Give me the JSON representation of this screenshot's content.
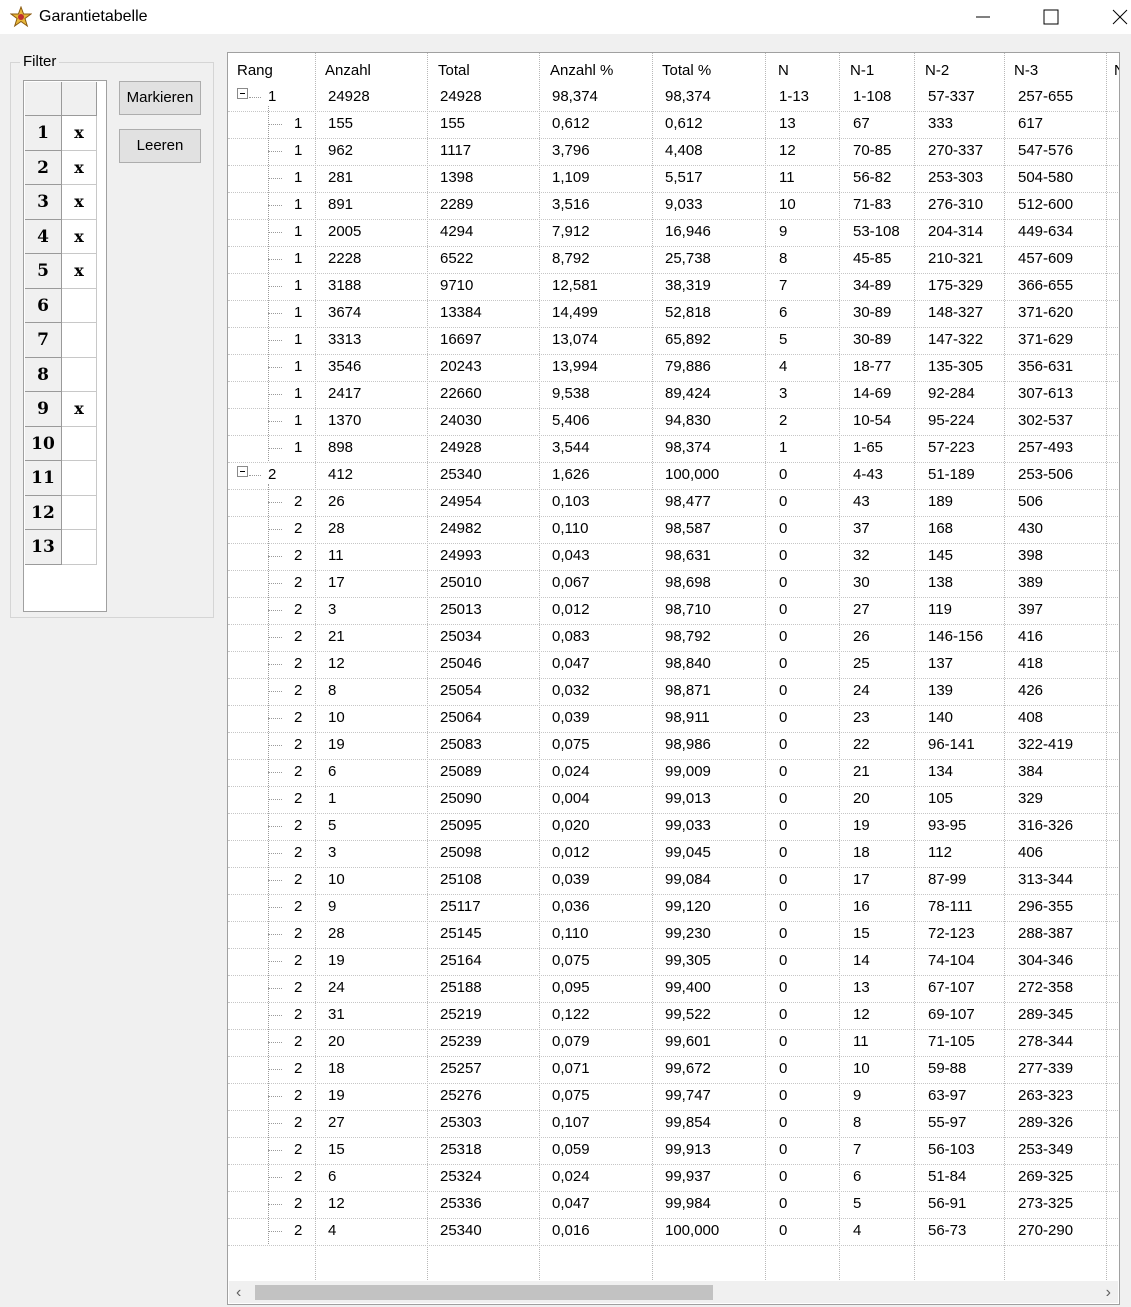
{
  "window": {
    "title": "Garantietabelle",
    "app_icon": "star-icon"
  },
  "filter": {
    "legend": "Filter",
    "rows": [
      {
        "num": "1",
        "mark": "x"
      },
      {
        "num": "2",
        "mark": "x"
      },
      {
        "num": "3",
        "mark": "x"
      },
      {
        "num": "4",
        "mark": "x"
      },
      {
        "num": "5",
        "mark": "x"
      },
      {
        "num": "6",
        "mark": ""
      },
      {
        "num": "7",
        "mark": ""
      },
      {
        "num": "8",
        "mark": ""
      },
      {
        "num": "9",
        "mark": "x"
      },
      {
        "num": "10",
        "mark": ""
      },
      {
        "num": "11",
        "mark": ""
      },
      {
        "num": "12",
        "mark": ""
      },
      {
        "num": "13",
        "mark": ""
      }
    ],
    "buttons": {
      "markieren": "Markieren",
      "leeren": "Leeren"
    }
  },
  "table": {
    "columns": [
      "Rang",
      "Anzahl",
      "Total",
      "Anzahl %",
      "Total %",
      "N",
      "N-1",
      "N-2",
      "N-3",
      "N"
    ],
    "rows": [
      {
        "level": 0,
        "expander": true,
        "rang": "1",
        "anzahl": "24928",
        "total": "24928",
        "anzahl_pct": "98,374",
        "total_pct": "98,374",
        "n": "1-13",
        "n1": "1-108",
        "n2": "57-337",
        "n3": "257-655"
      },
      {
        "level": 1,
        "rang": "1",
        "anzahl": "155",
        "total": "155",
        "anzahl_pct": "0,612",
        "total_pct": "0,612",
        "n": "13",
        "n1": "67",
        "n2": "333",
        "n3": "617"
      },
      {
        "level": 1,
        "rang": "1",
        "anzahl": "962",
        "total": "1117",
        "anzahl_pct": "3,796",
        "total_pct": "4,408",
        "n": "12",
        "n1": "70-85",
        "n2": "270-337",
        "n3": "547-576"
      },
      {
        "level": 1,
        "rang": "1",
        "anzahl": "281",
        "total": "1398",
        "anzahl_pct": "1,109",
        "total_pct": "5,517",
        "n": "11",
        "n1": "56-82",
        "n2": "253-303",
        "n3": "504-580"
      },
      {
        "level": 1,
        "rang": "1",
        "anzahl": "891",
        "total": "2289",
        "anzahl_pct": "3,516",
        "total_pct": "9,033",
        "n": "10",
        "n1": "71-83",
        "n2": "276-310",
        "n3": "512-600"
      },
      {
        "level": 1,
        "rang": "1",
        "anzahl": "2005",
        "total": "4294",
        "anzahl_pct": "7,912",
        "total_pct": "16,946",
        "n": "9",
        "n1": "53-108",
        "n2": "204-314",
        "n3": "449-634"
      },
      {
        "level": 1,
        "rang": "1",
        "anzahl": "2228",
        "total": "6522",
        "anzahl_pct": "8,792",
        "total_pct": "25,738",
        "n": "8",
        "n1": "45-85",
        "n2": "210-321",
        "n3": "457-609"
      },
      {
        "level": 1,
        "rang": "1",
        "anzahl": "3188",
        "total": "9710",
        "anzahl_pct": "12,581",
        "total_pct": "38,319",
        "n": "7",
        "n1": "34-89",
        "n2": "175-329",
        "n3": "366-655"
      },
      {
        "level": 1,
        "rang": "1",
        "anzahl": "3674",
        "total": "13384",
        "anzahl_pct": "14,499",
        "total_pct": "52,818",
        "n": "6",
        "n1": "30-89",
        "n2": "148-327",
        "n3": "371-620"
      },
      {
        "level": 1,
        "rang": "1",
        "anzahl": "3313",
        "total": "16697",
        "anzahl_pct": "13,074",
        "total_pct": "65,892",
        "n": "5",
        "n1": "30-89",
        "n2": "147-322",
        "n3": "371-629"
      },
      {
        "level": 1,
        "rang": "1",
        "anzahl": "3546",
        "total": "20243",
        "anzahl_pct": "13,994",
        "total_pct": "79,886",
        "n": "4",
        "n1": "18-77",
        "n2": "135-305",
        "n3": "356-631"
      },
      {
        "level": 1,
        "rang": "1",
        "anzahl": "2417",
        "total": "22660",
        "anzahl_pct": "9,538",
        "total_pct": "89,424",
        "n": "3",
        "n1": "14-69",
        "n2": "92-284",
        "n3": "307-613"
      },
      {
        "level": 1,
        "rang": "1",
        "anzahl": "1370",
        "total": "24030",
        "anzahl_pct": "5,406",
        "total_pct": "94,830",
        "n": "2",
        "n1": "10-54",
        "n2": "95-224",
        "n3": "302-537"
      },
      {
        "level": 1,
        "rang": "1",
        "anzahl": "898",
        "total": "24928",
        "anzahl_pct": "3,544",
        "total_pct": "98,374",
        "n": "1",
        "n1": "1-65",
        "n2": "57-223",
        "n3": "257-493"
      },
      {
        "level": 0,
        "expander": true,
        "rang": "2",
        "anzahl": "412",
        "total": "25340",
        "anzahl_pct": "1,626",
        "total_pct": "100,000",
        "n": "0",
        "n1": "4-43",
        "n2": "51-189",
        "n3": "253-506"
      },
      {
        "level": 1,
        "rang": "2",
        "anzahl": "26",
        "total": "24954",
        "anzahl_pct": "0,103",
        "total_pct": "98,477",
        "n": "0",
        "n1": "43",
        "n2": "189",
        "n3": "506"
      },
      {
        "level": 1,
        "rang": "2",
        "anzahl": "28",
        "total": "24982",
        "anzahl_pct": "0,110",
        "total_pct": "98,587",
        "n": "0",
        "n1": "37",
        "n2": "168",
        "n3": "430"
      },
      {
        "level": 1,
        "rang": "2",
        "anzahl": "11",
        "total": "24993",
        "anzahl_pct": "0,043",
        "total_pct": "98,631",
        "n": "0",
        "n1": "32",
        "n2": "145",
        "n3": "398"
      },
      {
        "level": 1,
        "rang": "2",
        "anzahl": "17",
        "total": "25010",
        "anzahl_pct": "0,067",
        "total_pct": "98,698",
        "n": "0",
        "n1": "30",
        "n2": "138",
        "n3": "389"
      },
      {
        "level": 1,
        "rang": "2",
        "anzahl": "3",
        "total": "25013",
        "anzahl_pct": "0,012",
        "total_pct": "98,710",
        "n": "0",
        "n1": "27",
        "n2": "119",
        "n3": "397"
      },
      {
        "level": 1,
        "rang": "2",
        "anzahl": "21",
        "total": "25034",
        "anzahl_pct": "0,083",
        "total_pct": "98,792",
        "n": "0",
        "n1": "26",
        "n2": "146-156",
        "n3": "416"
      },
      {
        "level": 1,
        "rang": "2",
        "anzahl": "12",
        "total": "25046",
        "anzahl_pct": "0,047",
        "total_pct": "98,840",
        "n": "0",
        "n1": "25",
        "n2": "137",
        "n3": "418"
      },
      {
        "level": 1,
        "rang": "2",
        "anzahl": "8",
        "total": "25054",
        "anzahl_pct": "0,032",
        "total_pct": "98,871",
        "n": "0",
        "n1": "24",
        "n2": "139",
        "n3": "426"
      },
      {
        "level": 1,
        "rang": "2",
        "anzahl": "10",
        "total": "25064",
        "anzahl_pct": "0,039",
        "total_pct": "98,911",
        "n": "0",
        "n1": "23",
        "n2": "140",
        "n3": "408"
      },
      {
        "level": 1,
        "rang": "2",
        "anzahl": "19",
        "total": "25083",
        "anzahl_pct": "0,075",
        "total_pct": "98,986",
        "n": "0",
        "n1": "22",
        "n2": "96-141",
        "n3": "322-419"
      },
      {
        "level": 1,
        "rang": "2",
        "anzahl": "6",
        "total": "25089",
        "anzahl_pct": "0,024",
        "total_pct": "99,009",
        "n": "0",
        "n1": "21",
        "n2": "134",
        "n3": "384"
      },
      {
        "level": 1,
        "rang": "2",
        "anzahl": "1",
        "total": "25090",
        "anzahl_pct": "0,004",
        "total_pct": "99,013",
        "n": "0",
        "n1": "20",
        "n2": "105",
        "n3": "329"
      },
      {
        "level": 1,
        "rang": "2",
        "anzahl": "5",
        "total": "25095",
        "anzahl_pct": "0,020",
        "total_pct": "99,033",
        "n": "0",
        "n1": "19",
        "n2": "93-95",
        "n3": "316-326"
      },
      {
        "level": 1,
        "rang": "2",
        "anzahl": "3",
        "total": "25098",
        "anzahl_pct": "0,012",
        "total_pct": "99,045",
        "n": "0",
        "n1": "18",
        "n2": "112",
        "n3": "406"
      },
      {
        "level": 1,
        "rang": "2",
        "anzahl": "10",
        "total": "25108",
        "anzahl_pct": "0,039",
        "total_pct": "99,084",
        "n": "0",
        "n1": "17",
        "n2": "87-99",
        "n3": "313-344"
      },
      {
        "level": 1,
        "rang": "2",
        "anzahl": "9",
        "total": "25117",
        "anzahl_pct": "0,036",
        "total_pct": "99,120",
        "n": "0",
        "n1": "16",
        "n2": "78-111",
        "n3": "296-355"
      },
      {
        "level": 1,
        "rang": "2",
        "anzahl": "28",
        "total": "25145",
        "anzahl_pct": "0,110",
        "total_pct": "99,230",
        "n": "0",
        "n1": "15",
        "n2": "72-123",
        "n3": "288-387"
      },
      {
        "level": 1,
        "rang": "2",
        "anzahl": "19",
        "total": "25164",
        "anzahl_pct": "0,075",
        "total_pct": "99,305",
        "n": "0",
        "n1": "14",
        "n2": "74-104",
        "n3": "304-346"
      },
      {
        "level": 1,
        "rang": "2",
        "anzahl": "24",
        "total": "25188",
        "anzahl_pct": "0,095",
        "total_pct": "99,400",
        "n": "0",
        "n1": "13",
        "n2": "67-107",
        "n3": "272-358"
      },
      {
        "level": 1,
        "rang": "2",
        "anzahl": "31",
        "total": "25219",
        "anzahl_pct": "0,122",
        "total_pct": "99,522",
        "n": "0",
        "n1": "12",
        "n2": "69-107",
        "n3": "289-345"
      },
      {
        "level": 1,
        "rang": "2",
        "anzahl": "20",
        "total": "25239",
        "anzahl_pct": "0,079",
        "total_pct": "99,601",
        "n": "0",
        "n1": "11",
        "n2": "71-105",
        "n3": "278-344"
      },
      {
        "level": 1,
        "rang": "2",
        "anzahl": "18",
        "total": "25257",
        "anzahl_pct": "0,071",
        "total_pct": "99,672",
        "n": "0",
        "n1": "10",
        "n2": "59-88",
        "n3": "277-339"
      },
      {
        "level": 1,
        "rang": "2",
        "anzahl": "19",
        "total": "25276",
        "anzahl_pct": "0,075",
        "total_pct": "99,747",
        "n": "0",
        "n1": "9",
        "n2": "63-97",
        "n3": "263-323"
      },
      {
        "level": 1,
        "rang": "2",
        "anzahl": "27",
        "total": "25303",
        "anzahl_pct": "0,107",
        "total_pct": "99,854",
        "n": "0",
        "n1": "8",
        "n2": "55-97",
        "n3": "289-326"
      },
      {
        "level": 1,
        "rang": "2",
        "anzahl": "15",
        "total": "25318",
        "anzahl_pct": "0,059",
        "total_pct": "99,913",
        "n": "0",
        "n1": "7",
        "n2": "56-103",
        "n3": "253-349"
      },
      {
        "level": 1,
        "rang": "2",
        "anzahl": "6",
        "total": "25324",
        "anzahl_pct": "0,024",
        "total_pct": "99,937",
        "n": "0",
        "n1": "6",
        "n2": "51-84",
        "n3": "269-325"
      },
      {
        "level": 1,
        "rang": "2",
        "anzahl": "12",
        "total": "25336",
        "anzahl_pct": "0,047",
        "total_pct": "99,984",
        "n": "0",
        "n1": "5",
        "n2": "56-91",
        "n3": "273-325"
      },
      {
        "level": 1,
        "rang": "2",
        "anzahl": "4",
        "total": "25340",
        "anzahl_pct": "0,016",
        "total_pct": "100,000",
        "n": "0",
        "n1": "4",
        "n2": "56-73",
        "n3": "270-290"
      }
    ]
  },
  "scrollbar": {
    "left_arrow": "‹",
    "right_arrow": "›"
  }
}
